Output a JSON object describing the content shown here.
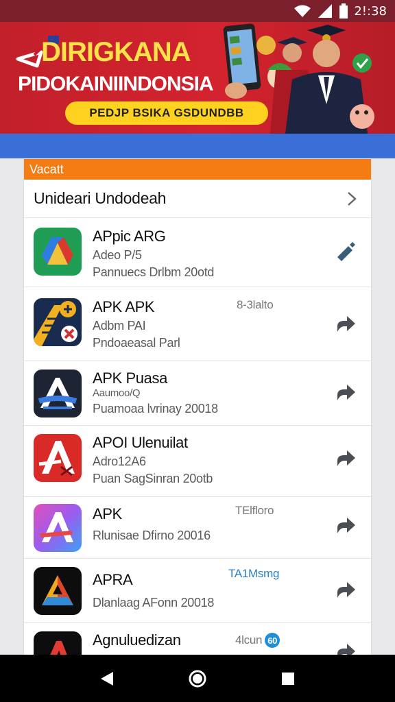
{
  "status_bar": {
    "time": "2!:38",
    "wifi_icon": "wifi-icon",
    "signal_icon": "signal-icon",
    "battery_icon": "battery-icon"
  },
  "banner": {
    "title": "DIRIGKANA",
    "subtitle": "PIDOKAINIINDONSIA",
    "pill_label": "PEDJP BSIKA GSDUNDBB",
    "accent_color": "#d3232e",
    "highlight_color": "#ffe14a"
  },
  "card": {
    "header": "Vacatt",
    "header_color": "#f57c12",
    "section_title": "Unideari Undodeah"
  },
  "apps": [
    {
      "name": "APpic ARG",
      "line1": "Adeo P/5",
      "line2": "Pannuecs Drlbm 20otd",
      "meta": "",
      "icon": "drive-like-icon",
      "action_icon": "edit-pencil-icon"
    },
    {
      "name": "APK APK",
      "line1": "Adbm PAI",
      "line2": "Pndoaeasal Parl",
      "meta": "8-3lalto",
      "icon": "road-sign-icon",
      "action_icon": "share-arrow-icon"
    },
    {
      "name": "APK Puasa",
      "line1": "Aaumoo/Q",
      "line2": "Puamoaa lvrinay 20018",
      "meta": "",
      "icon": "apk-a-blue-icon",
      "action_icon": "share-arrow-icon"
    },
    {
      "name": "APOI Ulenuilat",
      "line1": "Adro12A6",
      "line2": "Puan SagSinran 20otb",
      "meta": "",
      "icon": "apk-a-red-icon",
      "action_icon": "share-arrow-icon"
    },
    {
      "name": "APK",
      "line1": "",
      "line2": "Rlunisae Dfirno 20016",
      "meta": "TElfloro",
      "icon": "apk-a-gradient-icon",
      "action_icon": "share-arrow-icon"
    },
    {
      "name": "APRA",
      "line1": "",
      "line2": "Dlanlaag AFonn 20018",
      "meta": "TA1Msmg",
      "icon": "apk-a-dark-icon",
      "action_icon": "share-arrow-icon"
    },
    {
      "name": "Agnuluedizan",
      "line1": "",
      "line2": "",
      "meta": "4lcun",
      "meta_badge": "60",
      "icon": "apk-a-black-icon",
      "action_icon": "share-arrow-icon"
    }
  ],
  "nav": {
    "back_icon": "back-triangle-icon",
    "home_icon": "home-circle-icon",
    "recents_icon": "recents-square-icon"
  }
}
